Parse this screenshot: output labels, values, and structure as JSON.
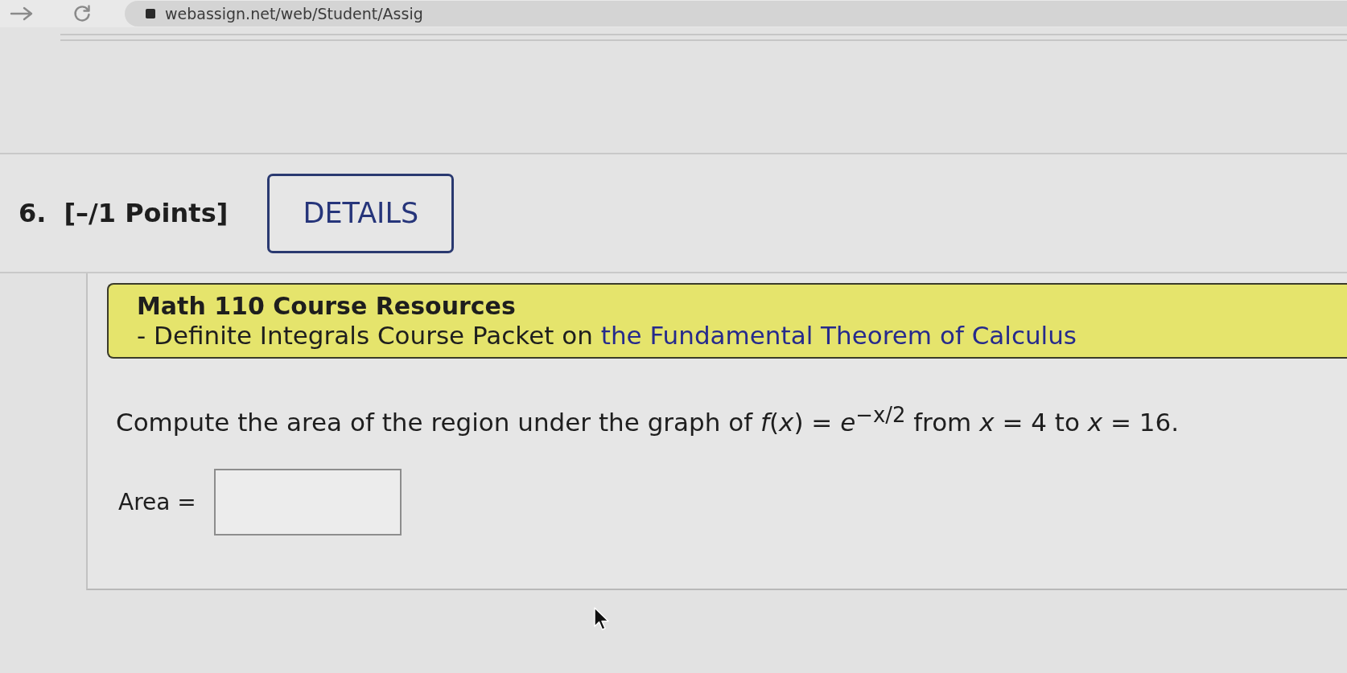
{
  "browser": {
    "address": "webassign.net/web/Student/Assig"
  },
  "question": {
    "number": "6.",
    "points": "[–/1 Points]",
    "details": "DETAILS"
  },
  "resources": {
    "title": "Math 110 Course Resources",
    "text": "- Definite Integrals Course Packet on ",
    "link": "the Fundamental Theorem of Calculus"
  },
  "prompt": "Compute the area of the region under the graph of *f*(*x*) = *e*$^{−x/2}$ from *x* = 4 to *x* = 16.",
  "answer": {
    "label": "Area ="
  }
}
